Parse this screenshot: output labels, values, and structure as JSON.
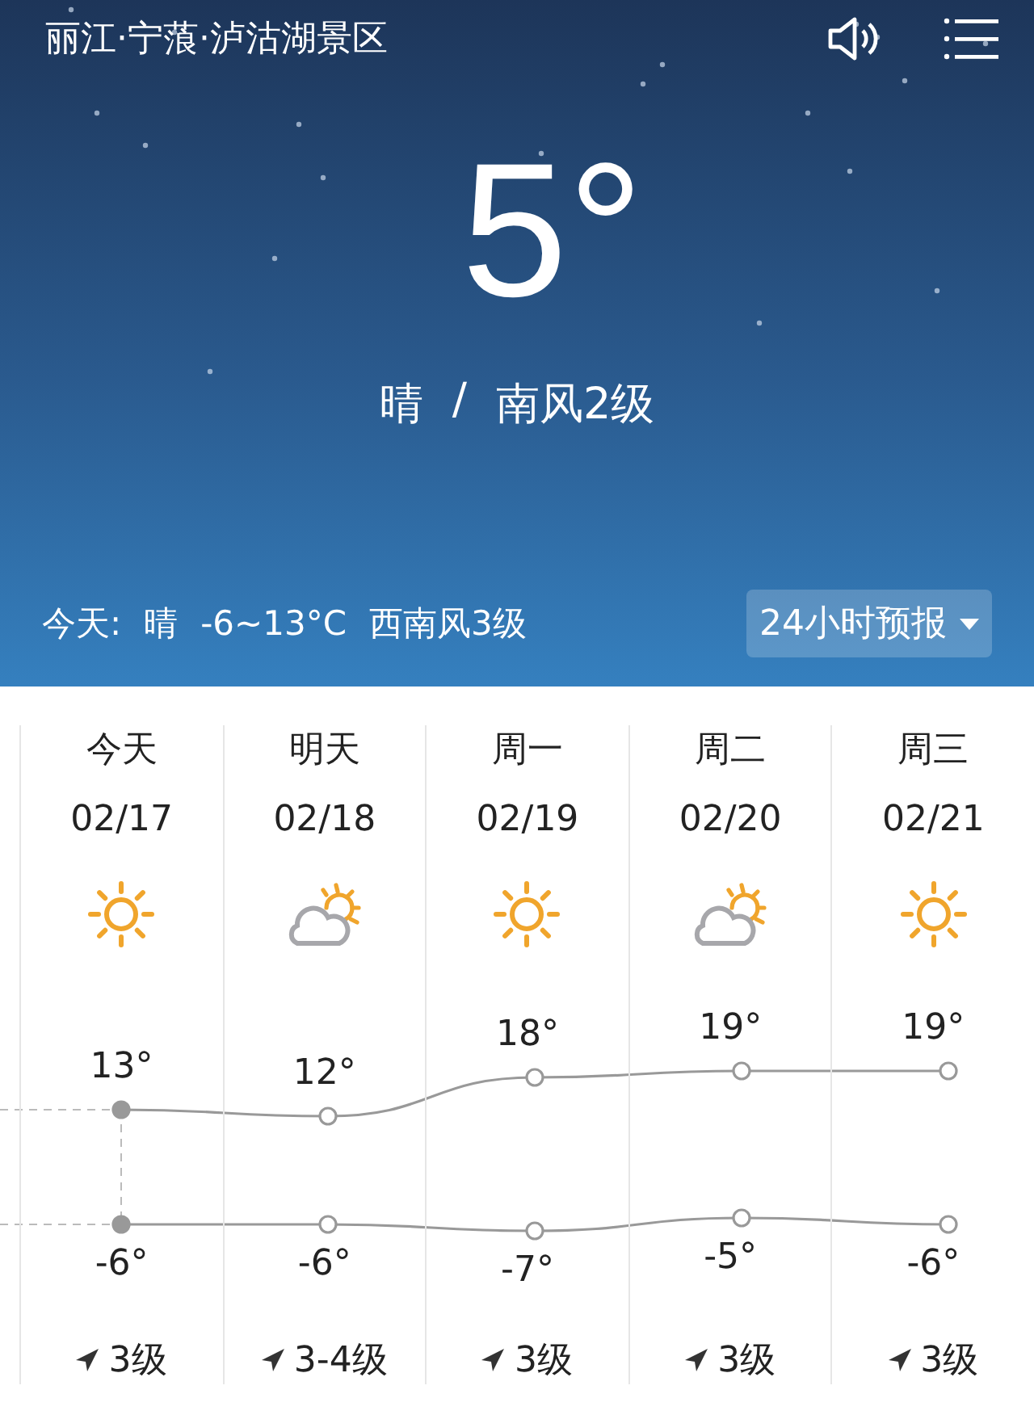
{
  "header": {
    "location": "丽江·宁蒗·泸沽湖景区",
    "temperature": "5°",
    "condition": "晴",
    "separator": "/",
    "wind": "南风2级"
  },
  "today": {
    "label": "今天:",
    "condition": "晴",
    "range": "-6~13°C",
    "wind": "西南风3级"
  },
  "forecast_button": {
    "label": "24小时预报"
  },
  "days": [
    {
      "day": "今天",
      "date": "02/17",
      "kind": "sunny",
      "high": "13°",
      "low": "-6°",
      "wind": "3级",
      "selected": true
    },
    {
      "day": "明天",
      "date": "02/18",
      "kind": "partly_cloudy",
      "high": "12°",
      "low": "-6°",
      "wind": "3-4级",
      "selected": false
    },
    {
      "day": "周一",
      "date": "02/19",
      "kind": "sunny",
      "high": "18°",
      "low": "-7°",
      "wind": "3级",
      "selected": false
    },
    {
      "day": "周二",
      "date": "02/20",
      "kind": "partly_cloudy",
      "high": "19°",
      "low": "-5°",
      "wind": "3级",
      "selected": false
    },
    {
      "day": "周三",
      "date": "02/21",
      "kind": "sunny",
      "high": "19°",
      "low": "-6°",
      "wind": "3级",
      "selected": false
    }
  ]
}
